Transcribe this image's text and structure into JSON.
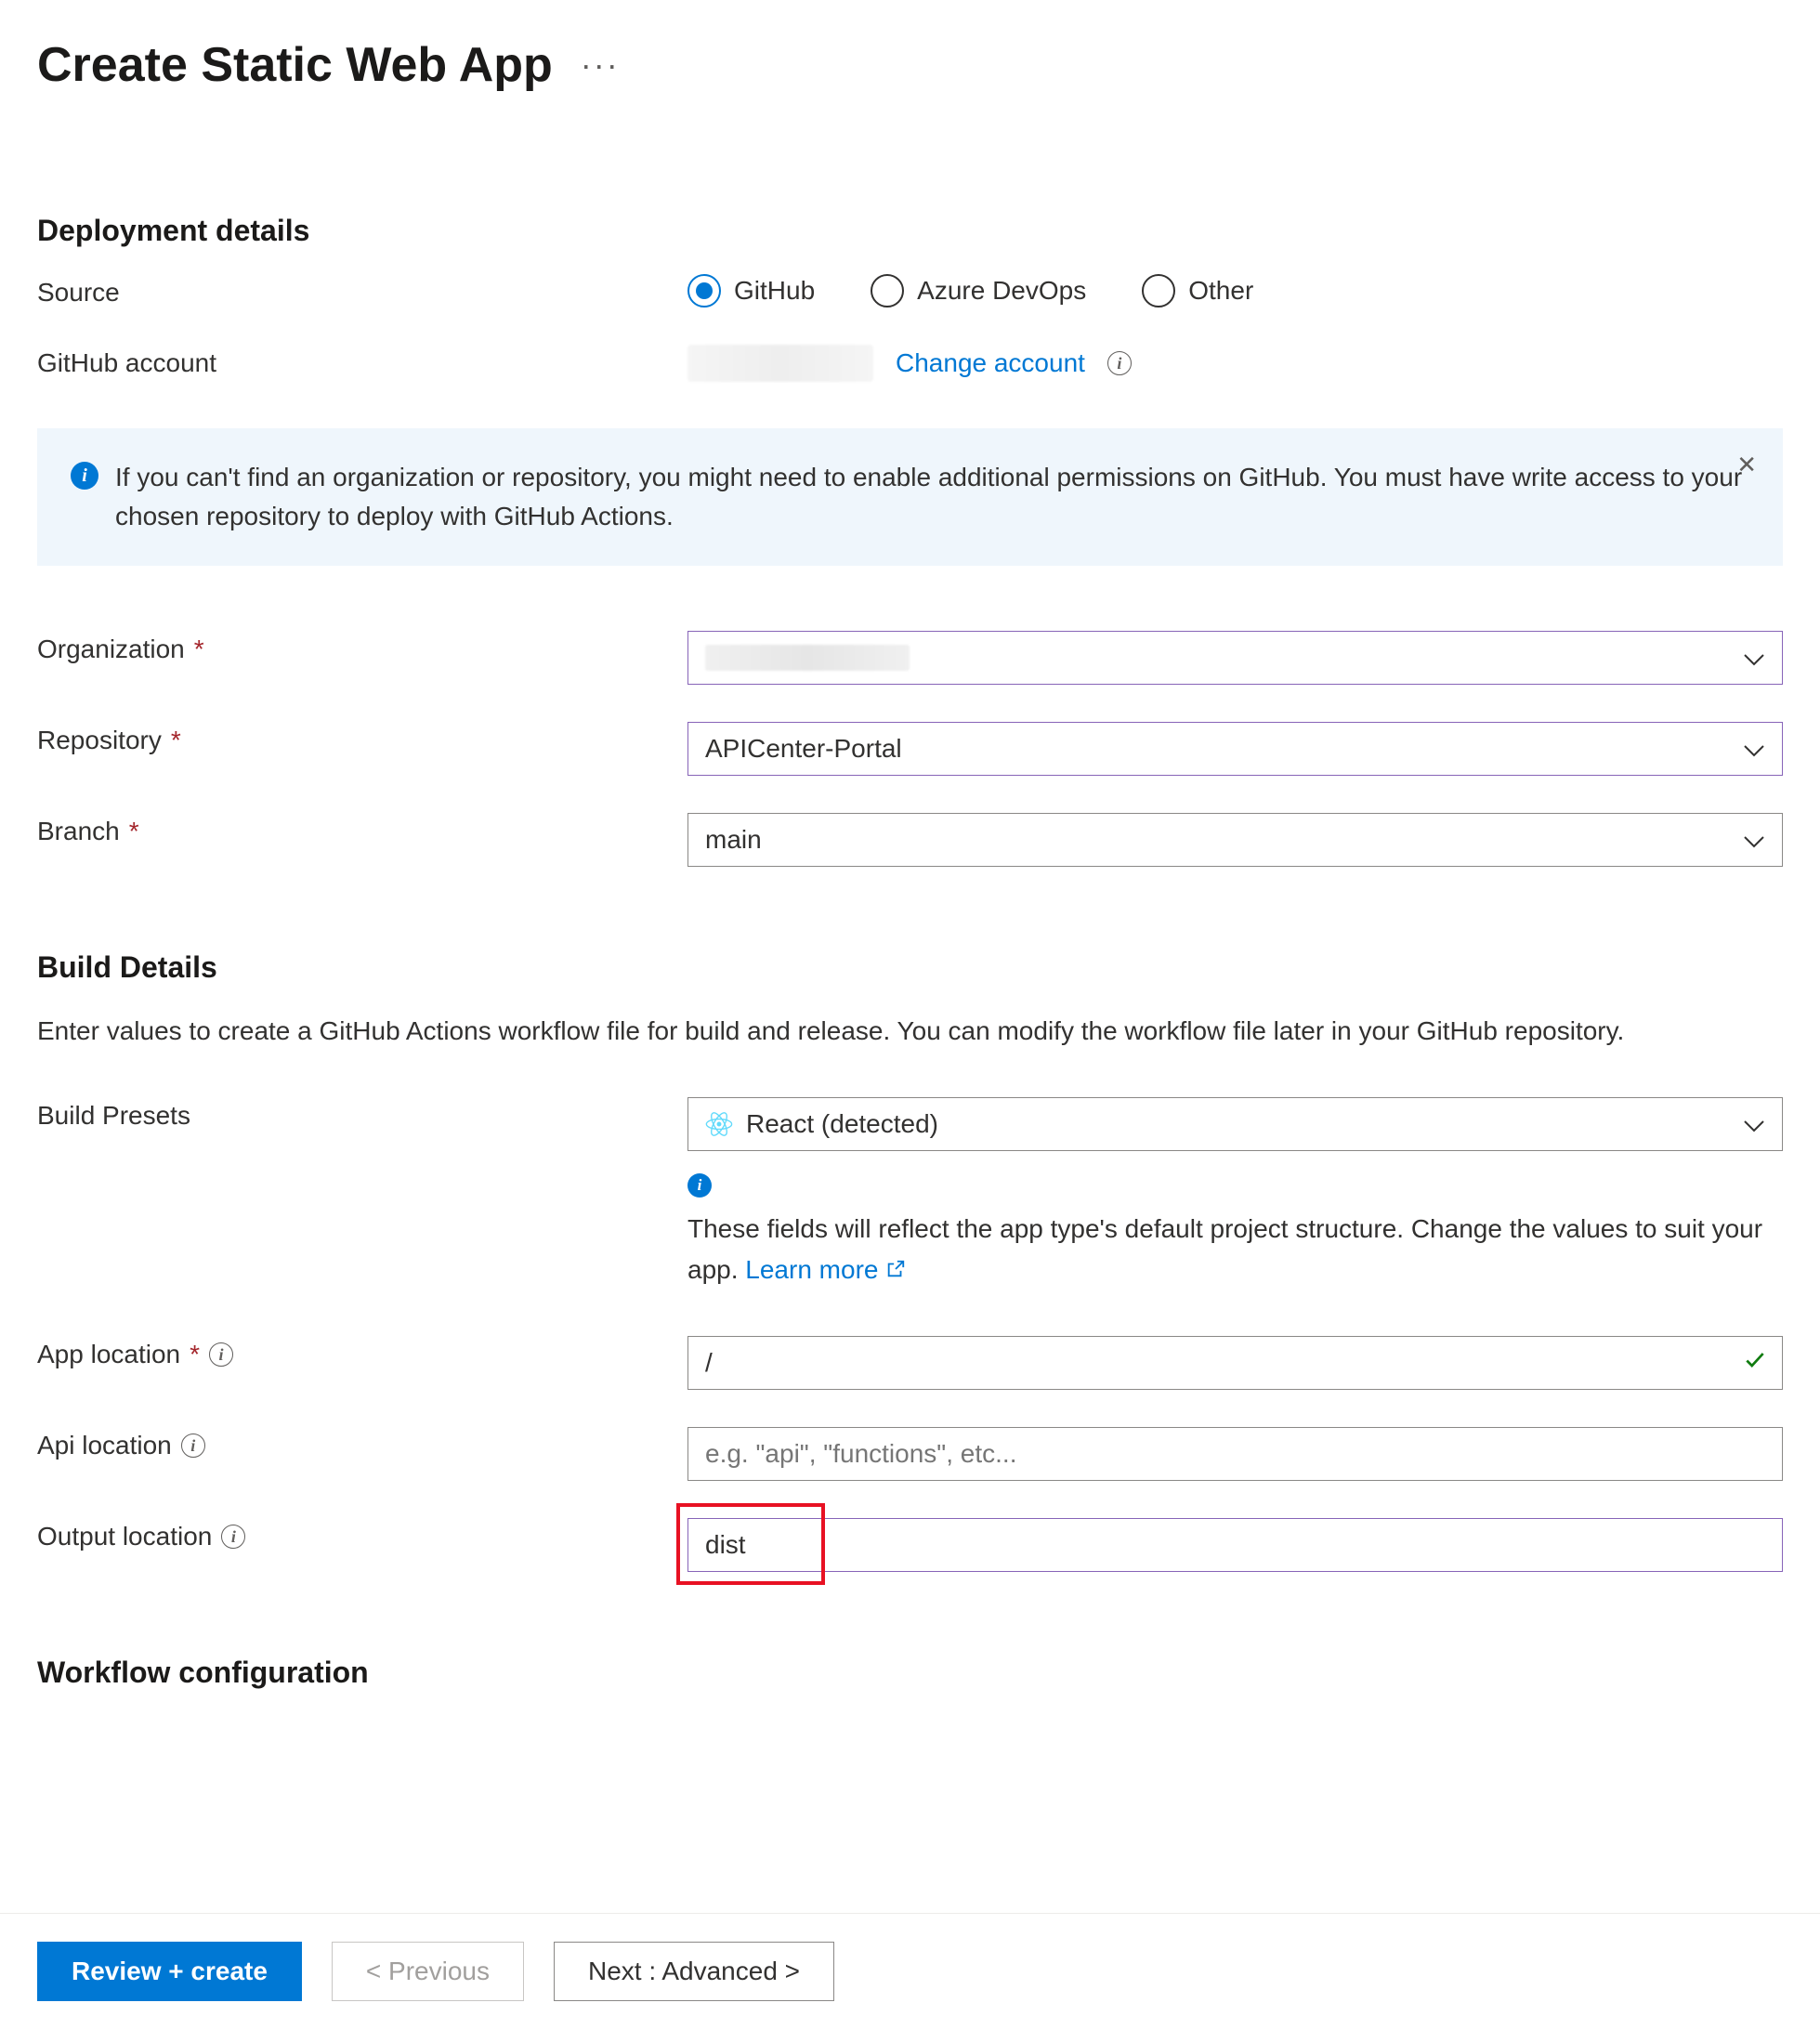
{
  "header": {
    "title": "Create Static Web App"
  },
  "deployment": {
    "section_title": "Deployment details",
    "source_label": "Source",
    "source_options": {
      "github": "GitHub",
      "devops": "Azure DevOps",
      "other": "Other"
    },
    "source_selected": "github",
    "github_account_label": "GitHub account",
    "change_account": "Change account"
  },
  "info_banner": {
    "text": "If you can't find an organization or repository, you might need to enable additional permissions on GitHub. You must have write access to your chosen repository to deploy with GitHub Actions."
  },
  "repo": {
    "organization_label": "Organization",
    "organization_value": "",
    "repository_label": "Repository",
    "repository_value": "APICenter-Portal",
    "branch_label": "Branch",
    "branch_value": "main"
  },
  "build": {
    "section_title": "Build Details",
    "description": "Enter values to create a GitHub Actions workflow file for build and release. You can modify the workflow file later in your GitHub repository.",
    "presets_label": "Build Presets",
    "presets_value": "React (detected)",
    "presets_hint": "These fields will reflect the app type's default project structure. Change the values to suit your app.",
    "learn_more": "Learn more",
    "app_location_label": "App location",
    "app_location_value": "/",
    "api_location_label": "Api location",
    "api_location_placeholder": "e.g. \"api\", \"functions\", etc...",
    "api_location_value": "",
    "output_location_label": "Output location",
    "output_location_value": "dist"
  },
  "workflow": {
    "section_title": "Workflow configuration"
  },
  "footer": {
    "review": "Review + create",
    "previous": "<  Previous",
    "next": "Next : Advanced  >"
  }
}
